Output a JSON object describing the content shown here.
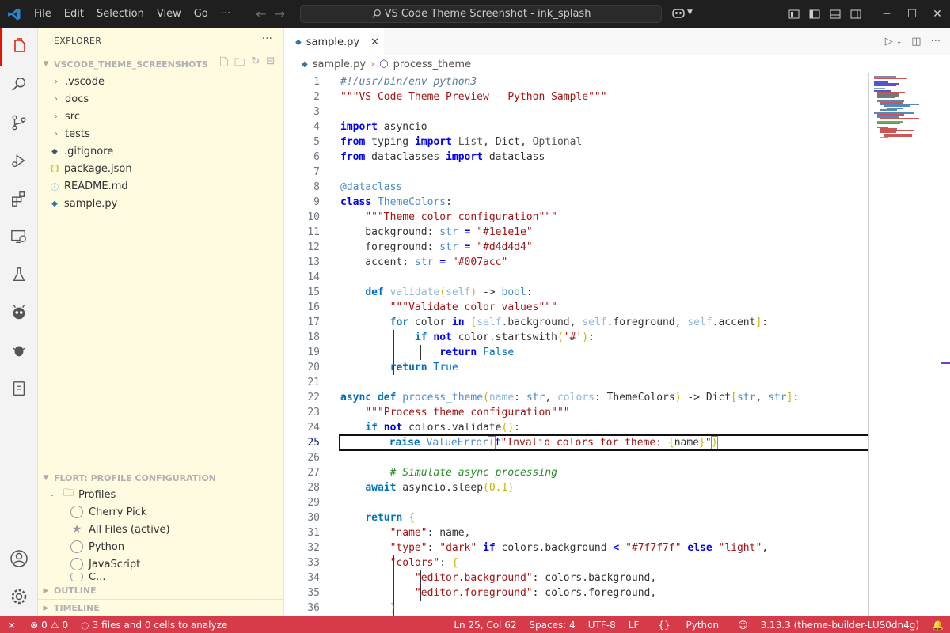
{
  "titlebar": {
    "menus": [
      "File",
      "Edit",
      "Selection",
      "View",
      "Go"
    ],
    "more": "···",
    "search_text": "VS Code Theme Screenshot - ink_splash"
  },
  "sidebar": {
    "title": "EXPLORER",
    "more": "···",
    "folder": "VSCODE_THEME_SCREENSHOTS",
    "tree": [
      {
        "label": ".vscode",
        "type": "folder"
      },
      {
        "label": "docs",
        "type": "folder"
      },
      {
        "label": "src",
        "type": "folder"
      },
      {
        "label": "tests",
        "type": "folder"
      },
      {
        "label": ".gitignore",
        "type": "gitignore"
      },
      {
        "label": "package.json",
        "type": "json"
      },
      {
        "label": "README.md",
        "type": "info"
      },
      {
        "label": "sample.py",
        "type": "python"
      }
    ],
    "profile_section": "FLORT: PROFILE CONFIGURATION",
    "profiles_label": "Profiles",
    "profiles": [
      "Cherry Pick",
      "All Files (active)",
      "Python",
      "JavaScript",
      "C..."
    ],
    "outline": "OUTLINE",
    "timeline": "TIMELINE"
  },
  "editor": {
    "tab_label": "sample.py",
    "breadcrumb_file": "sample.py",
    "breadcrumb_symbol": "process_theme",
    "line_numbers": [
      "1",
      "2",
      "3",
      "4",
      "5",
      "6",
      "7",
      "8",
      "9",
      "10",
      "11",
      "12",
      "13",
      "14",
      "15",
      "16",
      "17",
      "18",
      "19",
      "20",
      "21",
      "22",
      "23",
      "24",
      "25",
      "26",
      "27",
      "28",
      "29",
      "30",
      "31",
      "32",
      "33",
      "34",
      "35",
      "36"
    ],
    "current_line": 25
  },
  "statusbar": {
    "errors": "0",
    "warnings": "0",
    "analysis": "3 files and 0 cells to analyze",
    "position": "Ln 25, Col 62",
    "spaces": "Spaces: 4",
    "encoding": "UTF-8",
    "eol": "LF",
    "language": "Python",
    "interpreter": "3.13.3 (theme-builder-LUS0dn4g)"
  },
  "colors": {
    "statusbar": "#d73a49",
    "sidebar": "#fffbe0",
    "titlebar": "#1f1f1f",
    "active_accent": "#e51400"
  }
}
